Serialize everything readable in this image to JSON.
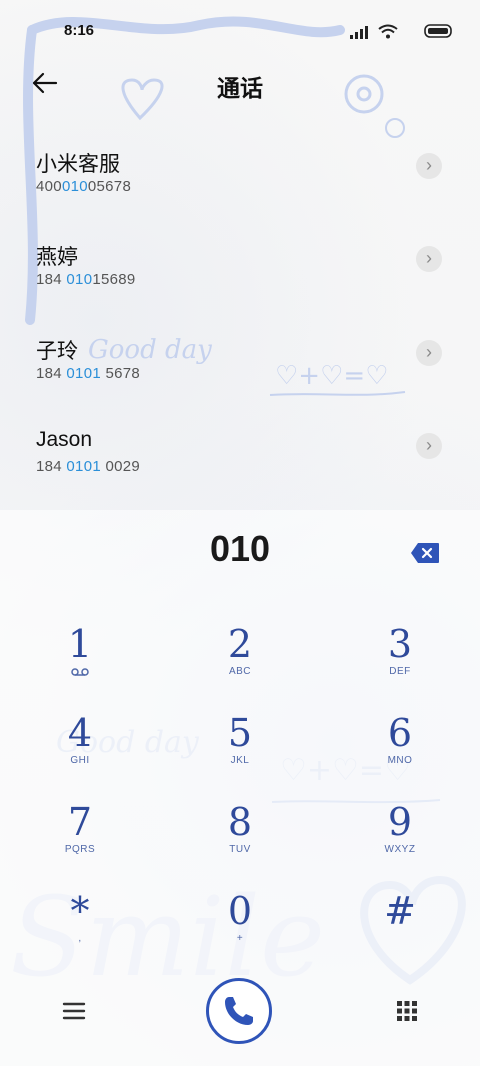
{
  "status_bar": {
    "time": "8:16"
  },
  "header": {
    "title": "通话"
  },
  "contacts": [
    {
      "name": "小米客服",
      "num_pre": "400",
      "num_hl": "010",
      "num_post": "05678"
    },
    {
      "name": "燕婷",
      "num_pre": "184 ",
      "num_hl": "010",
      "num_post": "15689"
    },
    {
      "name": "子玲",
      "num_pre": "184 ",
      "num_hl": "0101",
      "num_post": " 5678"
    },
    {
      "name": "Jason",
      "num_pre": "184 ",
      "num_hl": "0101",
      "num_post": " 0029"
    }
  ],
  "wallpaper_text": {
    "good_day": "Good day",
    "smile": "Smile",
    "equation": "♡+♡=♡"
  },
  "dialer": {
    "digits": "010",
    "keys": [
      {
        "digit": "1",
        "letters": ""
      },
      {
        "digit": "2",
        "letters": "ABC"
      },
      {
        "digit": "3",
        "letters": "DEF"
      },
      {
        "digit": "4",
        "letters": "GHI"
      },
      {
        "digit": "5",
        "letters": "JKL"
      },
      {
        "digit": "6",
        "letters": "MNO"
      },
      {
        "digit": "7",
        "letters": "PQRS"
      },
      {
        "digit": "8",
        "letters": "TUV"
      },
      {
        "digit": "9",
        "letters": "WXYZ"
      },
      {
        "digit": "*",
        "letters": ","
      },
      {
        "digit": "0",
        "letters": "+"
      },
      {
        "digit": "#",
        "letters": ""
      }
    ]
  },
  "colors": {
    "accent": "#2f54b8",
    "highlight": "#2b8fd8"
  }
}
